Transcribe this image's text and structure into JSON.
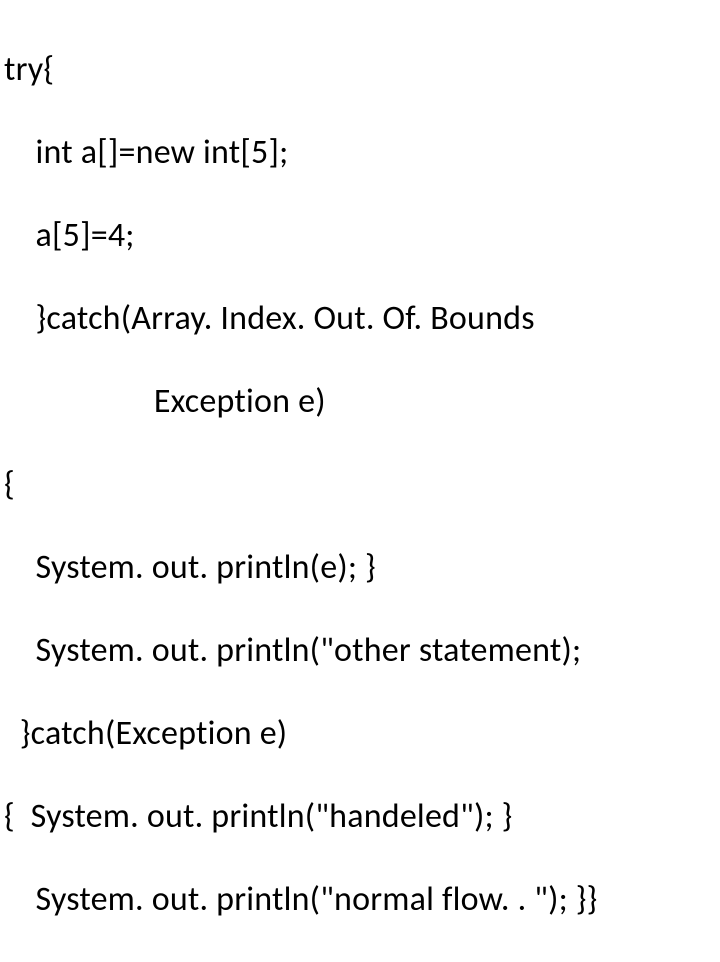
{
  "code": {
    "lines": [
      "try{",
      "    int a[]=new int[5];",
      "    a[5]=4;",
      "    }catch(Array. Index. Out. Of. Bounds",
      "                   Exception e)",
      "{",
      "    System. out. println(e); }",
      "    System. out. println(\"other statement);",
      "  }catch(Exception e)",
      "{  System. out. println(\"handeled\"); }",
      "    System. out. println(\"normal flow. . \"); }}"
    ]
  }
}
